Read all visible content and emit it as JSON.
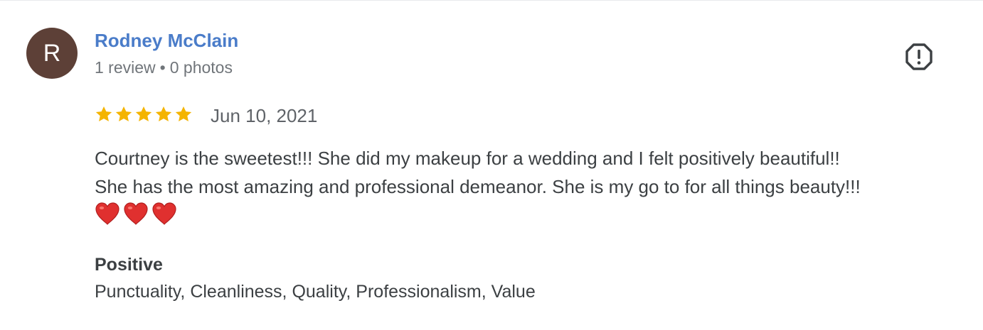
{
  "review": {
    "avatar_letter": "R",
    "avatar_color": "#5d4037",
    "reviewer_name": "Rodney McClain",
    "review_count": "1 review",
    "meta_separator": "•",
    "photo_count": "0 photos",
    "rating": 5,
    "rating_max": 5,
    "star_color": "#f4b400",
    "date": "Jun 10, 2021",
    "text_line_1": "Courtney is the sweetest!!! She did my makeup for a wedding and I felt positively beautiful!!",
    "text_line_2": "She has the most amazing and professional demeanor. She is my go to for all things beauty!!!",
    "hearts": [
      "red-heart-emoji",
      "red-heart-emoji",
      "red-heart-emoji"
    ],
    "positive_heading": "Positive",
    "positive_values": "Punctuality, Cleanliness, Quality, Professionalism, Value",
    "report_icon": "report-flag-icon"
  }
}
